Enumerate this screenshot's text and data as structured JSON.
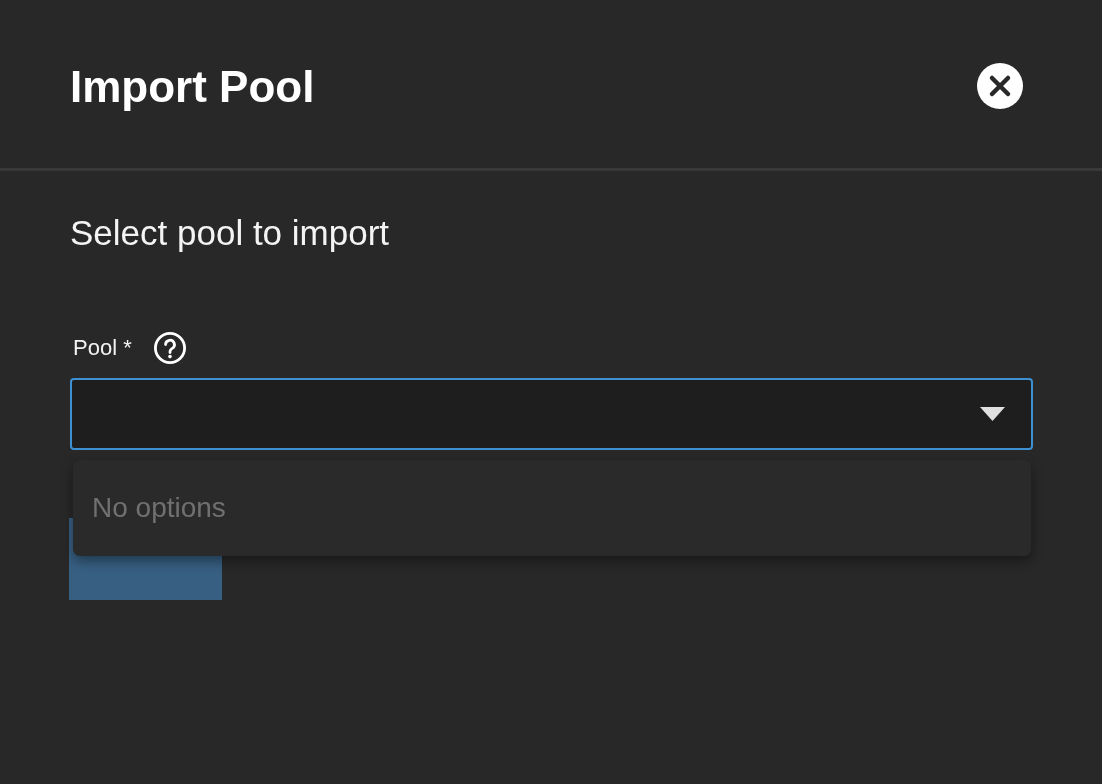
{
  "dialog": {
    "title": "Import Pool"
  },
  "heading": "Select pool to import",
  "pool_field": {
    "label": "Pool *",
    "expanded": true,
    "empty_message": "No options"
  },
  "buttons": [
    {
      "disabled": true
    }
  ]
}
